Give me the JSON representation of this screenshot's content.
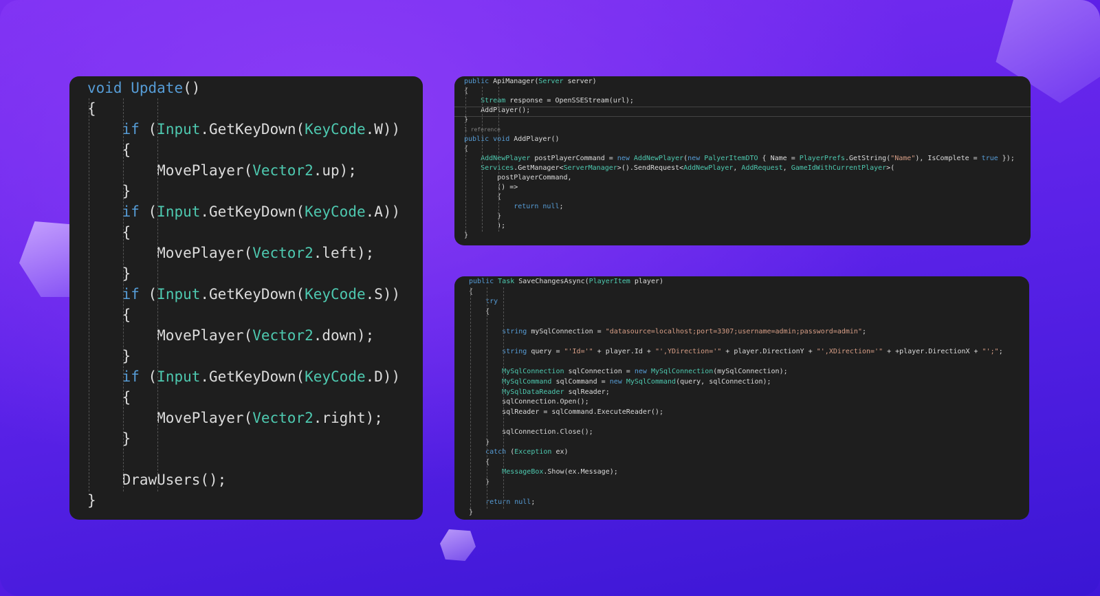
{
  "colors": {
    "keyword": "#569cd6",
    "type": "#4ec9b0",
    "string": "#d69d85",
    "text": "#dcdcdc",
    "panel": "#1e1e1e"
  },
  "panel_left": {
    "lines": [
      {
        "tokens": [
          [
            "kw",
            "void"
          ],
          [
            "t",
            " "
          ],
          [
            "kw",
            "Update"
          ],
          [
            "t",
            "()"
          ]
        ]
      },
      {
        "tokens": [
          [
            "t",
            "{"
          ]
        ]
      },
      {
        "tokens": [
          [
            "t",
            "    "
          ],
          [
            "kw",
            "if"
          ],
          [
            "t",
            " ("
          ],
          [
            "ty",
            "Input"
          ],
          [
            "t",
            ".GetKeyDown("
          ],
          [
            "ty",
            "KeyCode"
          ],
          [
            "t",
            ".W))"
          ]
        ]
      },
      {
        "tokens": [
          [
            "t",
            "    {"
          ]
        ]
      },
      {
        "tokens": [
          [
            "t",
            "        MovePlayer("
          ],
          [
            "ty",
            "Vector2"
          ],
          [
            "t",
            ".up);"
          ]
        ]
      },
      {
        "tokens": [
          [
            "t",
            "    }"
          ]
        ]
      },
      {
        "tokens": [
          [
            "t",
            "    "
          ],
          [
            "kw",
            "if"
          ],
          [
            "t",
            " ("
          ],
          [
            "ty",
            "Input"
          ],
          [
            "t",
            ".GetKeyDown("
          ],
          [
            "ty",
            "KeyCode"
          ],
          [
            "t",
            ".A))"
          ]
        ]
      },
      {
        "tokens": [
          [
            "t",
            "    {"
          ]
        ]
      },
      {
        "tokens": [
          [
            "t",
            "        MovePlayer("
          ],
          [
            "ty",
            "Vector2"
          ],
          [
            "t",
            ".left);"
          ]
        ]
      },
      {
        "tokens": [
          [
            "t",
            "    }"
          ]
        ]
      },
      {
        "tokens": [
          [
            "t",
            "    "
          ],
          [
            "kw",
            "if"
          ],
          [
            "t",
            " ("
          ],
          [
            "ty",
            "Input"
          ],
          [
            "t",
            ".GetKeyDown("
          ],
          [
            "ty",
            "KeyCode"
          ],
          [
            "t",
            ".S))"
          ]
        ]
      },
      {
        "tokens": [
          [
            "t",
            "    {"
          ]
        ]
      },
      {
        "tokens": [
          [
            "t",
            "        MovePlayer("
          ],
          [
            "ty",
            "Vector2"
          ],
          [
            "t",
            ".down);"
          ]
        ]
      },
      {
        "tokens": [
          [
            "t",
            "    }"
          ]
        ]
      },
      {
        "tokens": [
          [
            "t",
            "    "
          ],
          [
            "kw",
            "if"
          ],
          [
            "t",
            " ("
          ],
          [
            "ty",
            "Input"
          ],
          [
            "t",
            ".GetKeyDown("
          ],
          [
            "ty",
            "KeyCode"
          ],
          [
            "t",
            ".D))"
          ]
        ]
      },
      {
        "tokens": [
          [
            "t",
            "    {"
          ]
        ]
      },
      {
        "tokens": [
          [
            "t",
            "        MovePlayer("
          ],
          [
            "ty",
            "Vector2"
          ],
          [
            "t",
            ".right);"
          ]
        ]
      },
      {
        "tokens": [
          [
            "t",
            "    }"
          ]
        ]
      },
      {
        "tokens": [
          [
            "t",
            ""
          ]
        ]
      },
      {
        "tokens": [
          [
            "t",
            "    DrawUsers();"
          ]
        ]
      },
      {
        "tokens": [
          [
            "t",
            "}"
          ]
        ]
      }
    ]
  },
  "panel_top_right": {
    "lines": [
      {
        "tokens": [
          [
            "kw",
            "public"
          ],
          [
            "t",
            " ApiManager("
          ],
          [
            "ty",
            "Server"
          ],
          [
            "t",
            " server)"
          ]
        ]
      },
      {
        "tokens": [
          [
            "t",
            "{"
          ]
        ]
      },
      {
        "tokens": [
          [
            "t",
            "    "
          ],
          [
            "ty",
            "Stream"
          ],
          [
            "t",
            " response = OpenSSEStream(url);"
          ]
        ]
      },
      {
        "tokens": [
          [
            "t",
            "    AddPlayer();"
          ]
        ]
      },
      {
        "tokens": [
          [
            "t",
            "}"
          ]
        ]
      },
      {
        "tokens": [
          [
            "cm",
            "1 reference"
          ]
        ]
      },
      {
        "tokens": [
          [
            "kw",
            "public"
          ],
          [
            "t",
            " "
          ],
          [
            "kw",
            "void"
          ],
          [
            "t",
            " AddPlayer()"
          ]
        ]
      },
      {
        "tokens": [
          [
            "t",
            "{"
          ]
        ]
      },
      {
        "tokens": [
          [
            "t",
            "    "
          ],
          [
            "ty",
            "AddNewPlayer"
          ],
          [
            "t",
            " postPlayerCommand = "
          ],
          [
            "kw",
            "new"
          ],
          [
            "t",
            " "
          ],
          [
            "ty",
            "AddNewPlayer"
          ],
          [
            "t",
            "("
          ],
          [
            "kw",
            "new"
          ],
          [
            "t",
            " "
          ],
          [
            "ty",
            "PalyerItemDTO"
          ],
          [
            "t",
            " { Name = "
          ],
          [
            "ty",
            "PlayerPrefs"
          ],
          [
            "t",
            ".GetString("
          ],
          [
            "st",
            "\"Name\""
          ],
          [
            "t",
            "), IsComplete = "
          ],
          [
            "kw",
            "true"
          ],
          [
            "t",
            " });"
          ]
        ]
      },
      {
        "tokens": [
          [
            "t",
            "    "
          ],
          [
            "ty",
            "Services"
          ],
          [
            "t",
            ".GetManager<"
          ],
          [
            "ty",
            "ServerManager"
          ],
          [
            "t",
            ">().SendRequest<"
          ],
          [
            "ty",
            "AddNewPlayer"
          ],
          [
            "t",
            ", "
          ],
          [
            "ty",
            "AddRequest"
          ],
          [
            "t",
            ", "
          ],
          [
            "ty",
            "GameIdWithCurrentPlayer"
          ],
          [
            "t",
            ">("
          ]
        ]
      },
      {
        "tokens": [
          [
            "t",
            "        postPlayerCommand,"
          ]
        ]
      },
      {
        "tokens": [
          [
            "t",
            "        () =>"
          ]
        ]
      },
      {
        "tokens": [
          [
            "t",
            "        {"
          ]
        ]
      },
      {
        "tokens": [
          [
            "t",
            "            "
          ],
          [
            "kw",
            "return"
          ],
          [
            "t",
            " "
          ],
          [
            "kw",
            "null"
          ],
          [
            "t",
            ";"
          ]
        ]
      },
      {
        "tokens": [
          [
            "t",
            "        }"
          ]
        ]
      },
      {
        "tokens": [
          [
            "t",
            "        );"
          ]
        ]
      },
      {
        "tokens": [
          [
            "t",
            "}"
          ]
        ]
      }
    ]
  },
  "panel_bottom_right": {
    "lines": [
      {
        "tokens": [
          [
            "kw",
            "public"
          ],
          [
            "t",
            " "
          ],
          [
            "ty",
            "Task"
          ],
          [
            "t",
            " SaveChangesAsync("
          ],
          [
            "ty",
            "PlayerItem"
          ],
          [
            "t",
            " player)"
          ]
        ]
      },
      {
        "tokens": [
          [
            "t",
            "{"
          ]
        ]
      },
      {
        "tokens": [
          [
            "t",
            "    "
          ],
          [
            "kw",
            "try"
          ]
        ]
      },
      {
        "tokens": [
          [
            "t",
            "    {"
          ]
        ]
      },
      {
        "tokens": [
          [
            "t",
            ""
          ]
        ]
      },
      {
        "tokens": [
          [
            "t",
            "        "
          ],
          [
            "kw",
            "string"
          ],
          [
            "t",
            " mySqlConnection = "
          ],
          [
            "st",
            "\"datasource=localhost;port=3307;username=admin;password=admin\""
          ],
          [
            "t",
            ";"
          ]
        ]
      },
      {
        "tokens": [
          [
            "t",
            ""
          ]
        ]
      },
      {
        "tokens": [
          [
            "t",
            "        "
          ],
          [
            "kw",
            "string"
          ],
          [
            "t",
            " query = "
          ],
          [
            "st",
            "\"'Id='\""
          ],
          [
            "t",
            " + player.Id + "
          ],
          [
            "st",
            "\"',YDirection='\""
          ],
          [
            "t",
            " + player.DirectionY + "
          ],
          [
            "st",
            "\"',XDirection='\""
          ],
          [
            "t",
            " + +player.DirectionX + "
          ],
          [
            "st",
            "\"';\""
          ],
          [
            "t",
            ";"
          ]
        ]
      },
      {
        "tokens": [
          [
            "t",
            ""
          ]
        ]
      },
      {
        "tokens": [
          [
            "t",
            "        "
          ],
          [
            "ty",
            "MySqlConnection"
          ],
          [
            "t",
            " sqlConnection = "
          ],
          [
            "kw",
            "new"
          ],
          [
            "t",
            " "
          ],
          [
            "ty",
            "MySqlConnection"
          ],
          [
            "t",
            "(mySqlConnection);"
          ]
        ]
      },
      {
        "tokens": [
          [
            "t",
            "        "
          ],
          [
            "ty",
            "MySqlCommand"
          ],
          [
            "t",
            " sqlCommand = "
          ],
          [
            "kw",
            "new"
          ],
          [
            "t",
            " "
          ],
          [
            "ty",
            "MySqlCommand"
          ],
          [
            "t",
            "(query, sqlConnection);"
          ]
        ]
      },
      {
        "tokens": [
          [
            "t",
            "        "
          ],
          [
            "ty",
            "MySqlDataReader"
          ],
          [
            "t",
            " sqlReader;"
          ]
        ]
      },
      {
        "tokens": [
          [
            "t",
            "        sqlConnection.Open();"
          ]
        ]
      },
      {
        "tokens": [
          [
            "t",
            "        sqlReader = sqlCommand.ExecuteReader();"
          ]
        ]
      },
      {
        "tokens": [
          [
            "t",
            ""
          ]
        ]
      },
      {
        "tokens": [
          [
            "t",
            "        sqlConnection.Close();"
          ]
        ]
      },
      {
        "tokens": [
          [
            "t",
            "    }"
          ]
        ]
      },
      {
        "tokens": [
          [
            "t",
            "    "
          ],
          [
            "kw",
            "catch"
          ],
          [
            "t",
            " ("
          ],
          [
            "ty",
            "Exception"
          ],
          [
            "t",
            " ex)"
          ]
        ]
      },
      {
        "tokens": [
          [
            "t",
            "    {"
          ]
        ]
      },
      {
        "tokens": [
          [
            "t",
            "        "
          ],
          [
            "ty",
            "MessageBox"
          ],
          [
            "t",
            ".Show(ex.Message);"
          ]
        ]
      },
      {
        "tokens": [
          [
            "t",
            "    }"
          ]
        ]
      },
      {
        "tokens": [
          [
            "t",
            ""
          ]
        ]
      },
      {
        "tokens": [
          [
            "t",
            "    "
          ],
          [
            "kw",
            "return"
          ],
          [
            "t",
            " "
          ],
          [
            "kw",
            "null"
          ],
          [
            "t",
            ";"
          ]
        ]
      },
      {
        "tokens": [
          [
            "t",
            "}"
          ]
        ]
      }
    ]
  }
}
